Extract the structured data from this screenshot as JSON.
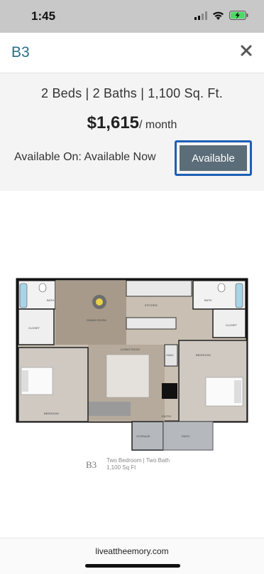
{
  "status_bar": {
    "time": "1:45"
  },
  "header": {
    "unit_name": "B3",
    "close_icon": "close-icon"
  },
  "details": {
    "specs": "2 Beds | 2 Baths | 1,100 Sq. Ft.",
    "price": "$1,615",
    "per_month": "/ month",
    "available_on": "Available On: Available Now",
    "available_button": "Available"
  },
  "floorplan": {
    "labels": {
      "bath_left": "BATH",
      "bath_right": "BATH",
      "dining": "DINING ROOM",
      "kitchen": "KITCHEN",
      "closet_left": "CLOSET",
      "closet_right": "CLOSET",
      "living": "LIVING ROOM",
      "bedroom_left": "BEDROOM",
      "bedroom_right": "BEDROOM",
      "hvac": "HVAC",
      "entry": "ENTRY",
      "storage": "STORAGE",
      "patio": "PATIO"
    },
    "caption_unit": "B3",
    "caption_line1": "Two Bedroom | Two Bath",
    "caption_line2": "1,100 Sq Ft"
  },
  "footer": {
    "url": "liveattheemory.com"
  },
  "colors": {
    "accent": "#2a6f86",
    "button": "#5b6d78",
    "focus_ring": "#1e5fb4"
  }
}
